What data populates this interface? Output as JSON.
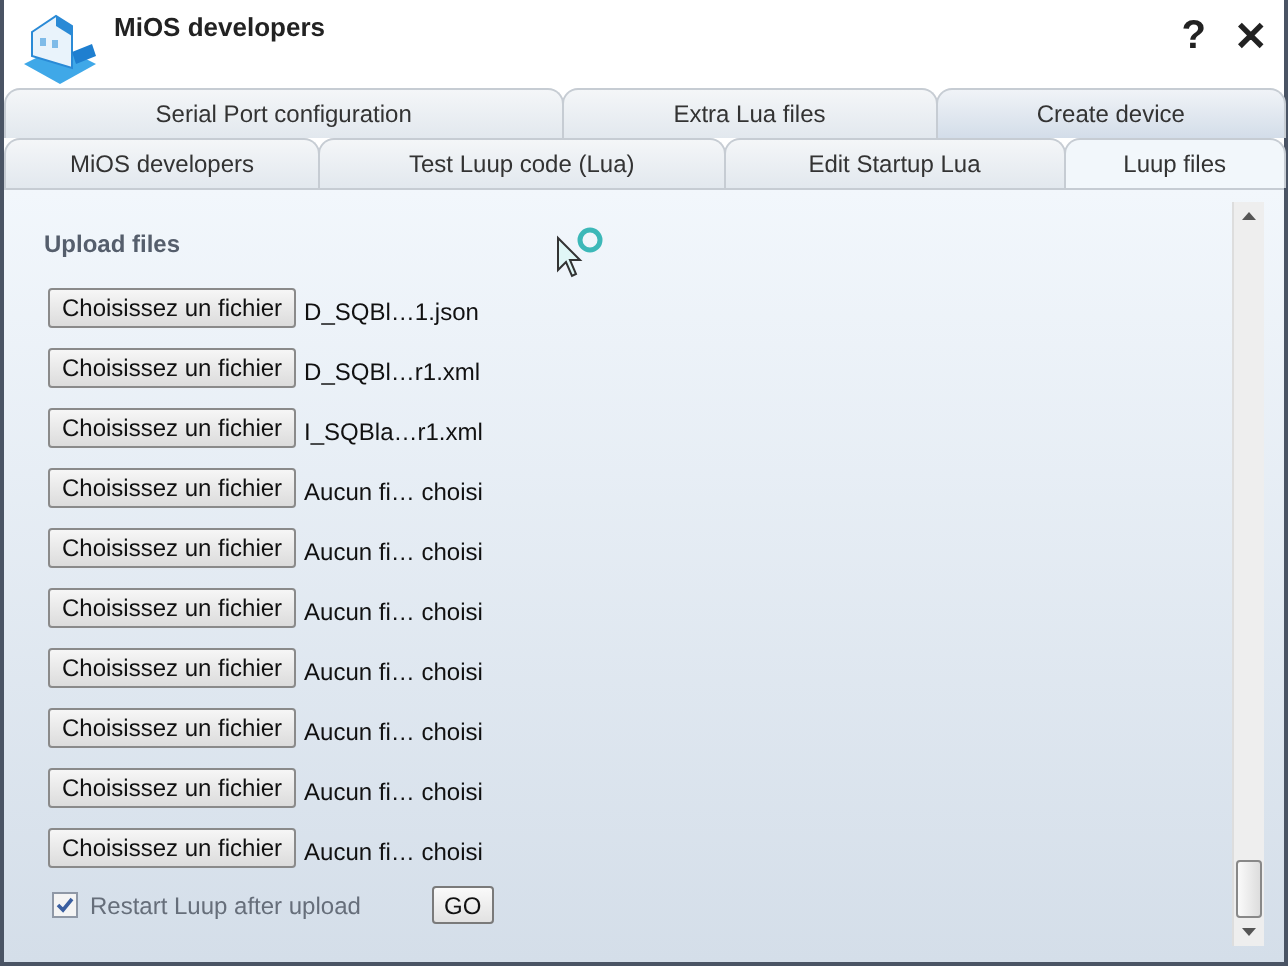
{
  "window": {
    "title": "MiOS developers"
  },
  "title_buttons": [
    "?",
    "✕"
  ],
  "tab_rows": [
    [
      {
        "label": "Serial Port configuration",
        "selected": false
      },
      {
        "label": "Extra Lua files",
        "selected": false
      },
      {
        "label": "Create device",
        "selected": false
      }
    ],
    [
      {
        "label": "MiOS developers",
        "selected": false
      },
      {
        "label": "Test Luup code (Lua)",
        "selected": false
      },
      {
        "label": "Edit Startup Lua",
        "selected": false
      },
      {
        "label": "Luup files",
        "selected": true
      }
    ]
  ],
  "section_title": "Upload files",
  "files": [
    {
      "button": "Choisissez un fichier",
      "file_name": "D_SQBl…1.json"
    },
    {
      "button": "Choisissez un fichier",
      "file_name": "D_SQBl…r1.xml"
    },
    {
      "button": "Choisissez un fichier",
      "file_name": "I_SQBla…r1.xml"
    },
    {
      "button": "Choisissez un fichier",
      "file_name": "Aucun fi… choisi"
    },
    {
      "button": "Choisissez un fichier",
      "file_name": "Aucun fi… choisi"
    },
    {
      "button": "Choisissez un fichier",
      "file_name": "Aucun fi… choisi"
    },
    {
      "button": "Choisissez un fichier",
      "file_name": "Aucun fi… choisi"
    },
    {
      "button": "Choisissez un fichier",
      "file_name": "Aucun fi… choisi"
    },
    {
      "button": "Choisissez un fichier",
      "file_name": "Aucun fi… choisi"
    },
    {
      "button": "Choisissez un fichier",
      "file_name": "Aucun fi… choisi"
    }
  ],
  "restart_option": {
    "label": "Restart Luup after upload",
    "checked": true
  },
  "go_button": "GO"
}
